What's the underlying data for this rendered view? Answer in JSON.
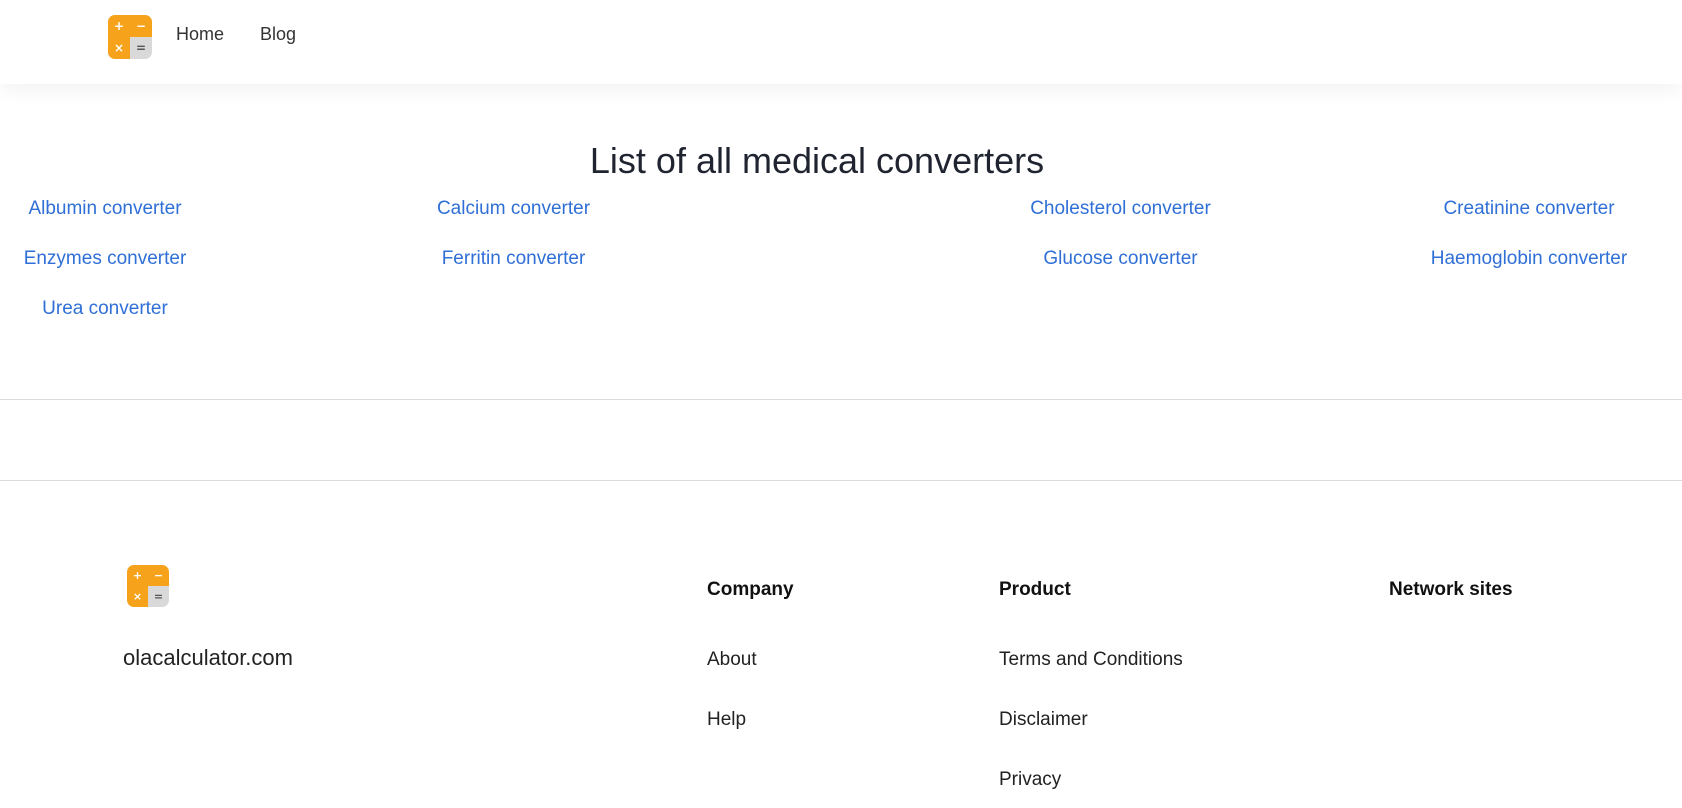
{
  "header": {
    "logo": {
      "icon": "calculator-logo-icon",
      "glyphs": [
        "+",
        "−",
        "×",
        "="
      ],
      "colors": {
        "primary": "#f7a21b",
        "secondary": "#d9d9d9"
      }
    },
    "nav": [
      {
        "label": "Home"
      },
      {
        "label": "Blog"
      }
    ]
  },
  "main": {
    "title": "List of all medical converters",
    "converters": [
      {
        "label": "Albumin converter"
      },
      {
        "label": "Calcium converter"
      },
      {
        "label": "Cholesterol converter"
      },
      {
        "label": "Creatinine converter"
      },
      {
        "label": "Enzymes converter"
      },
      {
        "label": "Ferritin converter"
      },
      {
        "label": "Glucose converter"
      },
      {
        "label": "Haemoglobin converter"
      },
      {
        "label": "Urea converter"
      }
    ],
    "link_color": "#2f6fd6"
  },
  "footer": {
    "brand": "olacalculator.com",
    "columns": {
      "company": {
        "heading": "Company",
        "links": [
          "About",
          "Help"
        ]
      },
      "product": {
        "heading": "Product",
        "links": [
          "Terms and Conditions",
          "Disclaimer",
          "Privacy"
        ]
      },
      "network": {
        "heading": "Network sites",
        "links": []
      }
    }
  }
}
